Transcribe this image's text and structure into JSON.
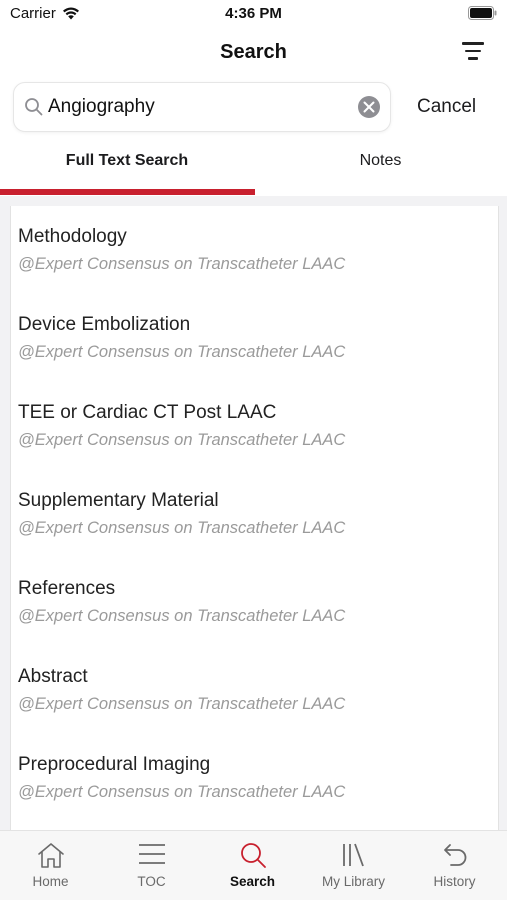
{
  "status_bar": {
    "carrier": "Carrier",
    "time": "4:36 PM"
  },
  "nav": {
    "title": "Search",
    "filter_icon": "filter-icon"
  },
  "search": {
    "value": "Angiography",
    "placeholder": "",
    "cancel_label": "Cancel"
  },
  "tabs": [
    {
      "label": "Full Text Search",
      "active": true
    },
    {
      "label": "Notes",
      "active": false
    }
  ],
  "results": [
    {
      "title": "Methodology",
      "source": "@Expert Consensus on Transcatheter LAAC"
    },
    {
      "title": "Device Embolization",
      "source": "@Expert Consensus on Transcatheter LAAC"
    },
    {
      "title": "TEE or Cardiac CT Post LAAC",
      "source": "@Expert Consensus on Transcatheter LAAC"
    },
    {
      "title": "Supplementary Material",
      "source": "@Expert Consensus on Transcatheter LAAC"
    },
    {
      "title": "References",
      "source": "@Expert Consensus on Transcatheter LAAC"
    },
    {
      "title": "Abstract",
      "source": "@Expert Consensus on Transcatheter LAAC"
    },
    {
      "title": "Preprocedural Imaging",
      "source": "@Expert Consensus on Transcatheter LAAC"
    }
  ],
  "tab_bar": [
    {
      "label": "Home",
      "icon": "home-icon",
      "active": false
    },
    {
      "label": "TOC",
      "icon": "list-icon",
      "active": false
    },
    {
      "label": "Search",
      "icon": "search-icon",
      "active": true
    },
    {
      "label": "My Library",
      "icon": "library-icon",
      "active": false
    },
    {
      "label": "History",
      "icon": "history-icon",
      "active": false
    }
  ],
  "colors": {
    "accent": "#c8202e",
    "text": "#1c1c1e",
    "secondary_text": "#9a9a9a",
    "tab_bar_inactive": "#6a6a6a"
  }
}
